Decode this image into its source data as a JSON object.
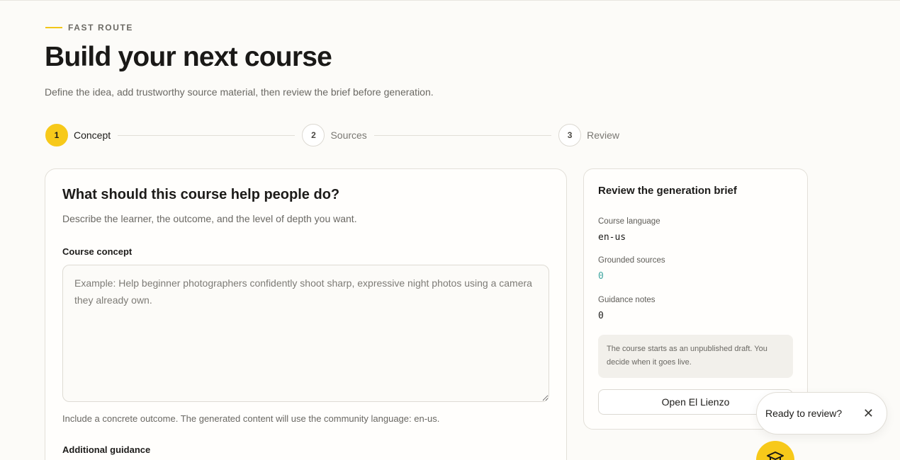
{
  "header": {
    "eyebrow": "FAST ROUTE",
    "title": "Build your next course",
    "subtitle": "Define the idea, add trustworthy source material, then review the brief before generation."
  },
  "steps": [
    {
      "number": "1",
      "label": "Concept",
      "active": true
    },
    {
      "number": "2",
      "label": "Sources",
      "active": false
    },
    {
      "number": "3",
      "label": "Review",
      "active": false
    }
  ],
  "concept_card": {
    "heading": "What should this course help people do?",
    "description": "Describe the learner, the outcome, and the level of depth you want.",
    "concept_label": "Course concept",
    "concept_value": "",
    "concept_placeholder": "Example: Help beginner photographers confidently shoot sharp, expressive night photos using a camera they already own.",
    "hint": "Include a concrete outcome. The generated content will use the community language: en-us.",
    "guidance_label": "Additional guidance"
  },
  "brief": {
    "heading": "Review the generation brief",
    "language_label": "Course language",
    "language_value": "en-us",
    "sources_label": "Grounded sources",
    "sources_value": "0",
    "guidance_label": "Guidance notes",
    "guidance_value": "0",
    "note": "The course starts as an unpublished draft. You decide when it goes live.",
    "open_button": "Open El Lienzo"
  },
  "toast": {
    "text": "Ready to review?",
    "close_icon": "close-icon"
  },
  "fab": {
    "icon": "graduation-cap-icon"
  },
  "colors": {
    "accent": "#f7c91a",
    "teal": "#3fa6a0",
    "background": "#fcfbf8"
  }
}
